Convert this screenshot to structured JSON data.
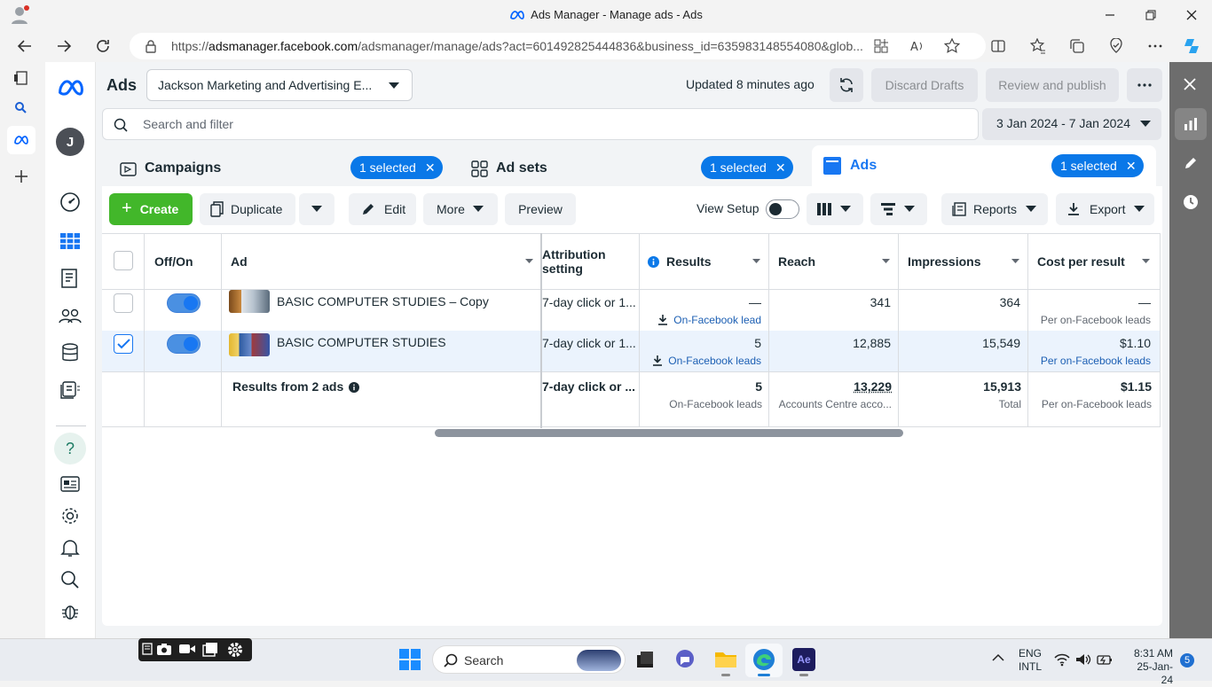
{
  "window": {
    "title": "Ads Manager - Manage ads - Ads"
  },
  "browser": {
    "url_prefix": "https://",
    "url_domain": "adsmanager.facebook.com",
    "url_rest": "/adsmanager/manage/ads?act=601492825444836&business_id=635983148554080&glob..."
  },
  "header": {
    "section_title": "Ads",
    "account_name": "Jackson Marketing and Advertising E...",
    "updated_text": "Updated 8 minutes ago",
    "discard_label": "Discard Drafts",
    "review_label": "Review and publish",
    "search_placeholder": "Search and filter",
    "date_range": "3 Jan 2024 - 7 Jan 2024",
    "avatar_letter": "J"
  },
  "tabs": [
    {
      "label": "Campaigns",
      "selected_label": "1 selected"
    },
    {
      "label": "Ad sets",
      "selected_label": "1 selected"
    },
    {
      "label": "Ads",
      "selected_label": "1 selected"
    }
  ],
  "toolbar": {
    "create_label": "Create",
    "duplicate_label": "Duplicate",
    "edit_label": "Edit",
    "more_label": "More",
    "preview_label": "Preview",
    "view_setup_label": "View Setup",
    "reports_label": "Reports",
    "export_label": "Export"
  },
  "table": {
    "columns": {
      "offon": "Off/On",
      "ad": "Ad",
      "attribution": "Attribution setting",
      "results": "Results",
      "reach": "Reach",
      "impressions": "Impressions",
      "cost": "Cost per result"
    },
    "rows": [
      {
        "name": "BASIC COMPUTER STUDIES – Copy",
        "attribution": "7-day click or 1...",
        "results": "—",
        "results_sub": "On-Facebook lead",
        "reach": "341",
        "impressions": "364",
        "cost": "—",
        "cost_sub": "Per on-Facebook leads",
        "checked": false
      },
      {
        "name": "BASIC COMPUTER STUDIES",
        "attribution": "7-day click or 1...",
        "results": "5",
        "results_sub": "On-Facebook leads",
        "reach": "12,885",
        "impressions": "15,549",
        "cost": "$1.10",
        "cost_sub": "Per on-Facebook leads",
        "checked": true
      }
    ],
    "summary": {
      "label": "Results from 2 ads",
      "attribution": "7-day click or ...",
      "results": "5",
      "results_sub": "On-Facebook leads",
      "reach": "13,229",
      "reach_sub": "Accounts Centre acco...",
      "impressions": "15,913",
      "impressions_sub": "Total",
      "cost": "$1.15",
      "cost_sub": "Per on-Facebook leads"
    }
  },
  "taskbar": {
    "search_label": "Search",
    "lang_top": "ENG",
    "lang_bottom": "INTL",
    "time": "8:31 AM",
    "date": "25-Jan-24",
    "notification_count": "5"
  },
  "colors": {
    "accent": "#0a78e8",
    "create_green": "#42b72a",
    "meta_blue": "#0866ff"
  }
}
